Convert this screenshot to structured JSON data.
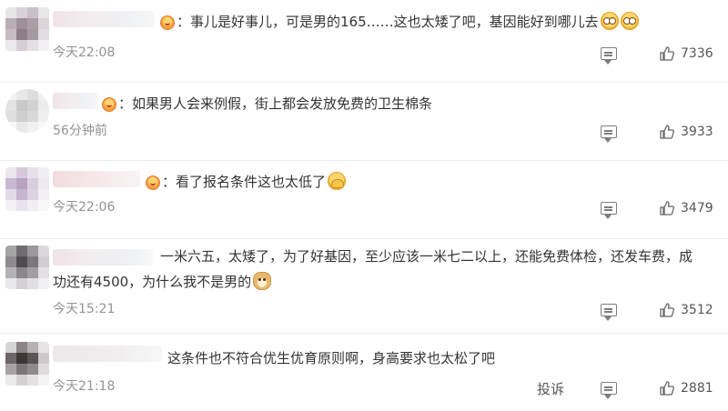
{
  "comments": [
    {
      "text": "：事儿是好事儿，可是男的165……这也太矮了吧，基因能好到哪儿去",
      "emoji": [
        "surprised-emoji",
        "surprised-emoji"
      ],
      "time": "今天22:08",
      "likes": "7336"
    },
    {
      "text": "：如果男人会来例假，街上都会发放免费的卫生棉条",
      "emoji": [],
      "time": "56分钟前",
      "likes": "3933"
    },
    {
      "text": "：看了报名条件这也太低了",
      "emoji": [
        "hiding-face-emoji"
      ],
      "time": "今天22:06",
      "likes": "3479"
    },
    {
      "text_line1": "一米六五，太矮了，为了好基因，至少应该一米七二以上，还能免费体检，还发车费，成",
      "text_line2": "功还有4500，为什么我不是男的",
      "emoji": [
        "doge-emoji"
      ],
      "time": "今天15:21",
      "likes": "3512"
    },
    {
      "text": "这条件也不符合优生优育原则啊，身高要求也太松了吧",
      "emoji": [],
      "time": "今天21:18",
      "report": "投诉",
      "likes": "2881"
    }
  ],
  "icons": {
    "reply": "comment-bubble-icon",
    "like": "thumbs-up-icon"
  },
  "colors": {
    "text": "#333333",
    "meta": "#939393",
    "divider": "#ededed"
  }
}
